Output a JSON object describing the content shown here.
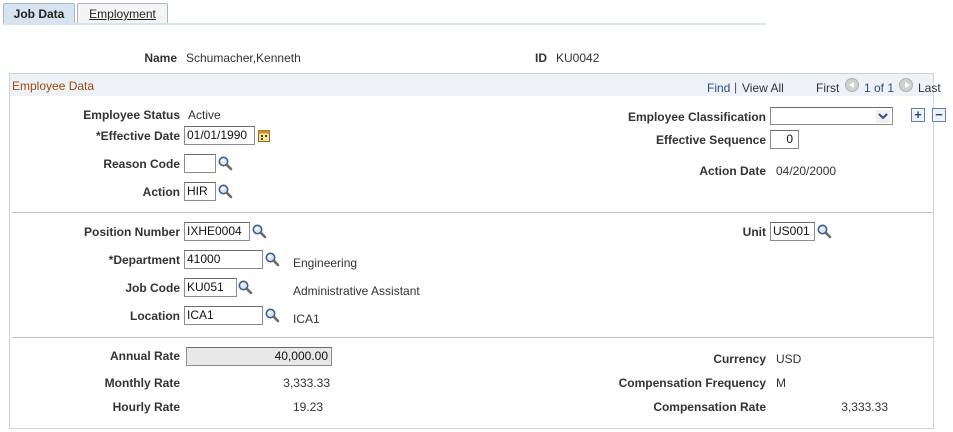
{
  "tabs": [
    {
      "label": "Job Data"
    },
    {
      "label": "Employment"
    }
  ],
  "header": {
    "name_label": "Name",
    "name_value": "Schumacher,Kenneth",
    "id_label": "ID",
    "id_value": "KU0042"
  },
  "section": {
    "title": "Employee Data",
    "find": "Find",
    "view_all": "View All",
    "first": "First",
    "page_info": "1 of 1",
    "last": "Last"
  },
  "employee": {
    "status_label": "Employee Status",
    "status_value": "Active",
    "effective_date_label": "Effective Date",
    "effective_date_value": "01/01/1990",
    "reason_code_label": "Reason Code",
    "reason_code_value": "",
    "action_label": "Action",
    "action_value": "HIR",
    "classification_label": "Employee Classification",
    "classification_value": "",
    "effective_sequence_label": "Effective Sequence",
    "effective_sequence_value": "0",
    "action_date_label": "Action Date",
    "action_date_value": "04/20/2000"
  },
  "position": {
    "position_number_label": "Position Number",
    "position_number_value": "IXHE0004",
    "department_label": "Department",
    "department_value": "41000",
    "department_desc": "Engineering",
    "job_code_label": "Job Code",
    "job_code_value": "KU051",
    "job_code_desc": "Administrative Assistant",
    "location_label": "Location",
    "location_value": "ICA1",
    "location_desc": "ICA1",
    "unit_label": "Unit",
    "unit_value": "US001"
  },
  "compensation": {
    "annual_rate_label": "Annual Rate",
    "annual_rate_value": "40,000.00",
    "monthly_rate_label": "Monthly Rate",
    "monthly_rate_value": "3,333.33",
    "hourly_rate_label": "Hourly Rate",
    "hourly_rate_value": "19.23",
    "currency_label": "Currency",
    "currency_value": "USD",
    "frequency_label": "Compensation Frequency",
    "frequency_value": "M",
    "comp_rate_label": "Compensation Rate",
    "comp_rate_value": "3,333.33"
  },
  "required_marker": "*",
  "icons": {
    "lookup": "magnifier-icon",
    "calendar": "calendar-icon",
    "add": "plus-icon",
    "delete": "minus-icon",
    "first": "left-arrow-icon",
    "last": "right-arrow-icon"
  }
}
